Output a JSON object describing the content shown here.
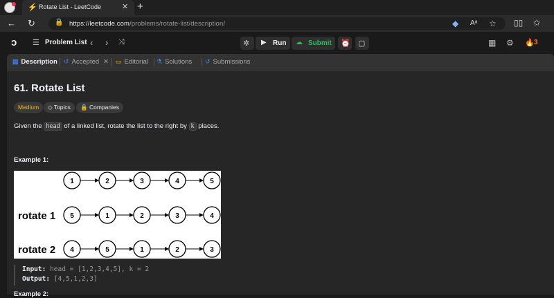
{
  "browser": {
    "tab_title": "Rotate List - LeetCode",
    "url_host": "https://leetcode.com",
    "url_path": "/problems/rotate-list/description/"
  },
  "header": {
    "problem_list": "Problem List",
    "run": "Run",
    "submit": "Submit",
    "streak": "3"
  },
  "panel_tabs": {
    "description": "Description",
    "accepted": "Accepted",
    "editorial": "Editorial",
    "solutions": "Solutions",
    "submissions": "Submissions"
  },
  "problem": {
    "title": "61. Rotate List",
    "difficulty": "Medium",
    "topics": "Topics",
    "companies": "Companies",
    "desc_1": "Given the ",
    "desc_head": "head",
    "desc_2": " of a linked list, rotate the list to the right by ",
    "desc_k": "k",
    "desc_3": " places.",
    "example1_title": "Example 1:",
    "input_label": "Input:",
    "input_value": "head = [1,2,3,4,5], k = 2",
    "output_label": "Output:",
    "output_value": "[4,5,1,2,3]",
    "example2_title": "Example 2:"
  },
  "diagram": {
    "rows": [
      {
        "label": "",
        "nodes": [
          "1",
          "2",
          "3",
          "4",
          "5"
        ]
      },
      {
        "label": "rotate 1",
        "nodes": [
          "5",
          "1",
          "2",
          "3",
          "4"
        ]
      },
      {
        "label": "rotate 2",
        "nodes": [
          "4",
          "5",
          "1",
          "2",
          "3"
        ]
      }
    ]
  },
  "colors": {
    "accent": "#ffa116",
    "submit_green": "#2cbb5d",
    "medium": "#ffb800",
    "tab_blue": "#3b82f6",
    "tab_yellow": "#ffb800"
  }
}
